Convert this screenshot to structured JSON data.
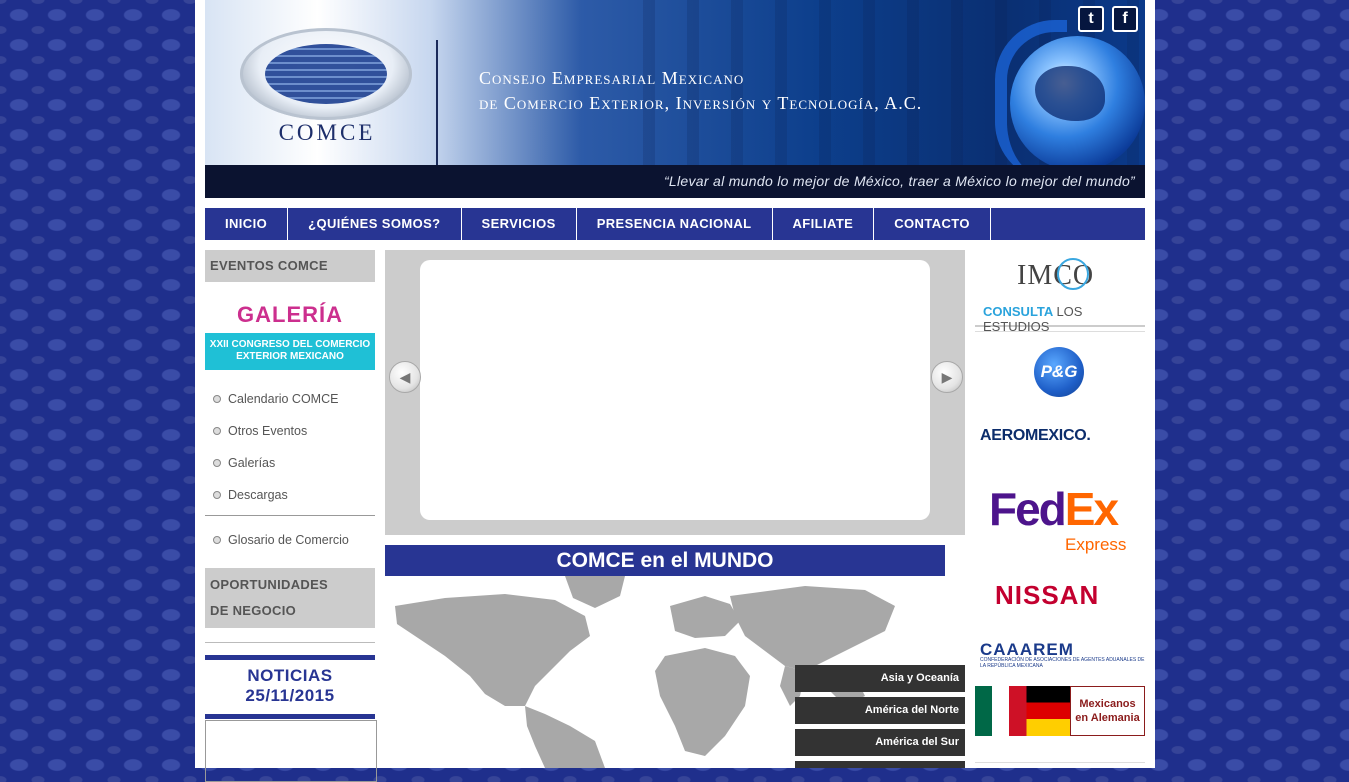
{
  "header": {
    "logo_text": "COMCE",
    "org_line1": "Consejo Empresarial Mexicano",
    "org_line2": "de Comercio Exterior, Inversión y Tecnología, A.C.",
    "tagline": "“Llevar al mundo lo mejor de México, traer a México lo mejor del mundo”",
    "social": {
      "twitter": "t",
      "facebook": "f"
    }
  },
  "nav": {
    "items": [
      "INICIO",
      "¿QUIÉNES SOMOS?",
      "SERVICIOS",
      "PRESENCIA NACIONAL",
      "AFILIATE",
      "CONTACTO"
    ]
  },
  "left": {
    "eventos_title": "EVENTOS COMCE",
    "galeria": "GALERÍA",
    "congreso_line1": "XXII CONGRESO DEL COMERCIO",
    "congreso_line2": "EXTERIOR MEXICANO",
    "links": [
      "Calendario COMCE",
      "Otros Eventos",
      "Galerías",
      "Descargas"
    ],
    "glosario": "Glosario de Comercio",
    "oportunidades_line1": "OPORTUNIDADES",
    "oportunidades_line2": "DE NEGOCIO",
    "noticias_title": "NOTICIAS",
    "noticias_date": "25/11/2015"
  },
  "center": {
    "mundo_title": "COMCE en el MUNDO",
    "regions": [
      "Asia y Oceanía",
      "América del Norte",
      "América del Sur"
    ]
  },
  "right": {
    "imco_name": "IMCO",
    "consulta": "CONSULTA",
    "los_estudios": "LOS ESTUDIOS",
    "pg": "P&G",
    "aeromexico": "AEROMEXICO.",
    "fedex_fe": "Fed",
    "fedex_ex": "Ex",
    "fedex_express": "Express",
    "nissan": "NISSAN",
    "caaarem": "CAAAREM",
    "caaarem_sub": "CONFEDERACIÓN DE ASOCIACIONES DE AGENTES ADUANALES DE LA REPÚBLICA MEXICANA",
    "mexicanos_line1": "Mexicanos",
    "mexicanos_line2": "en Alemania"
  },
  "colors": {
    "nav_blue": "#283593",
    "accent_cyan": "#1fc0d6",
    "galeria_pink": "#cc2f8e"
  }
}
